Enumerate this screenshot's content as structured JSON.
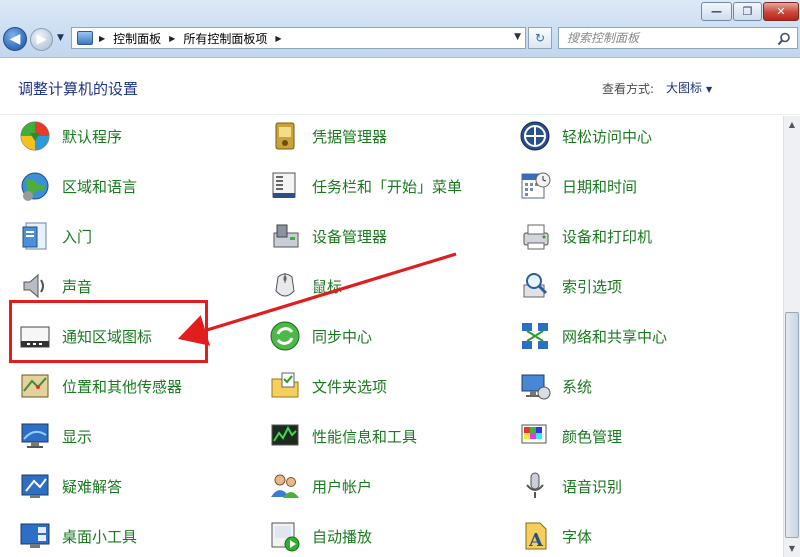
{
  "window": {
    "minimize_glyph": "—",
    "maximize_glyph": "❐",
    "close_glyph": "✕"
  },
  "nav": {
    "back_glyph": "◀",
    "forward_glyph": "▶",
    "history_glyph": "▼"
  },
  "address": {
    "breadcrumb": [
      "控制面板",
      "所有控制面板项"
    ],
    "separator": "▶",
    "dropdown_glyph": "▼"
  },
  "refresh_glyph": "↻",
  "search": {
    "placeholder": "搜索控制面板"
  },
  "header": {
    "title": "调整计算机的设置",
    "view_label": "查看方式:",
    "view_value": "大图标",
    "view_caret": "▼"
  },
  "items": [
    [
      "默认程序",
      "凭据管理器",
      "轻松访问中心"
    ],
    [
      "区域和语言",
      "任务栏和「开始」菜单",
      "日期和时间"
    ],
    [
      "入门",
      "设备管理器",
      "设备和打印机"
    ],
    [
      "声音",
      "鼠标",
      "索引选项"
    ],
    [
      "通知区域图标",
      "同步中心",
      "网络和共享中心"
    ],
    [
      "位置和其他传感器",
      "文件夹选项",
      "系统"
    ],
    [
      "显示",
      "性能信息和工具",
      "颜色管理"
    ],
    [
      "疑难解答",
      "用户帐户",
      "语音识别"
    ],
    [
      "桌面小工具",
      "自动播放",
      "字体"
    ]
  ],
  "scrollbar": {
    "up_glyph": "▲",
    "down_glyph": "▼"
  },
  "colors": {
    "item_label": "#1a7a1f",
    "title": "#1e3287",
    "annotation": "#e11d1d"
  }
}
